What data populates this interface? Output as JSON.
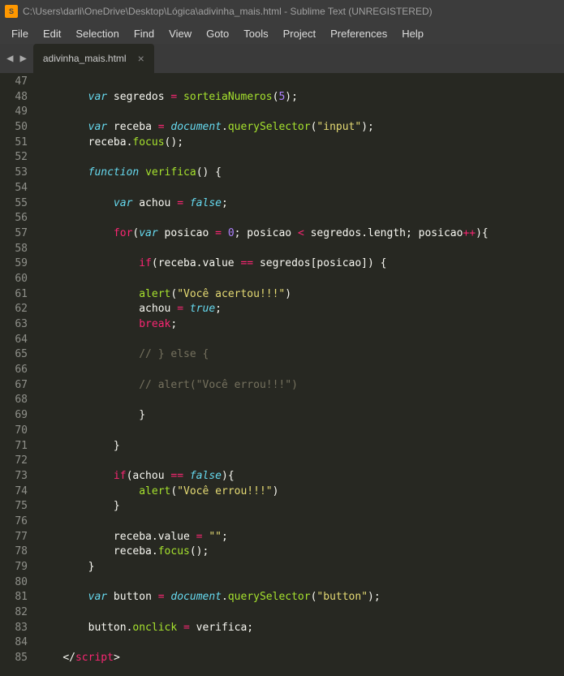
{
  "window": {
    "title": "C:\\Users\\darli\\OneDrive\\Desktop\\Lógica\\adivinha_mais.html - Sublime Text (UNREGISTERED)"
  },
  "menu": {
    "items": [
      "File",
      "Edit",
      "Selection",
      "Find",
      "View",
      "Goto",
      "Tools",
      "Project",
      "Preferences",
      "Help"
    ]
  },
  "tab": {
    "name": "adivinha_mais.html"
  },
  "gutter": {
    "start": 47,
    "end": 85
  },
  "code": {
    "lines": [
      {
        "n": 47,
        "indent": 1,
        "tokens": []
      },
      {
        "n": 48,
        "indent": 0,
        "tokens": [
          {
            "t": "        ",
            "c": "punc"
          },
          {
            "t": "var",
            "c": "stor"
          },
          {
            "t": " segredos ",
            "c": "name"
          },
          {
            "t": "=",
            "c": "kw2"
          },
          {
            "t": " ",
            "c": "punc"
          },
          {
            "t": "sorteiaNumeros",
            "c": "func"
          },
          {
            "t": "(",
            "c": "punc"
          },
          {
            "t": "5",
            "c": "num"
          },
          {
            "t": ");",
            "c": "punc"
          }
        ]
      },
      {
        "n": 49,
        "indent": 1,
        "tokens": []
      },
      {
        "n": 50,
        "indent": 0,
        "tokens": [
          {
            "t": "        ",
            "c": "punc"
          },
          {
            "t": "var",
            "c": "stor"
          },
          {
            "t": " receba ",
            "c": "name"
          },
          {
            "t": "=",
            "c": "kw2"
          },
          {
            "t": " ",
            "c": "punc"
          },
          {
            "t": "document",
            "c": "stor"
          },
          {
            "t": ".",
            "c": "punc"
          },
          {
            "t": "querySelector",
            "c": "func"
          },
          {
            "t": "(",
            "c": "punc"
          },
          {
            "t": "\"input\"",
            "c": "str"
          },
          {
            "t": ");",
            "c": "punc"
          }
        ]
      },
      {
        "n": 51,
        "indent": 0,
        "tokens": [
          {
            "t": "        receba.",
            "c": "name"
          },
          {
            "t": "focus",
            "c": "func"
          },
          {
            "t": "();",
            "c": "punc"
          }
        ]
      },
      {
        "n": 52,
        "indent": 1,
        "tokens": []
      },
      {
        "n": 53,
        "indent": 0,
        "tokens": [
          {
            "t": "        ",
            "c": "punc"
          },
          {
            "t": "function",
            "c": "stor"
          },
          {
            "t": " ",
            "c": "punc"
          },
          {
            "t": "verifica",
            "c": "func"
          },
          {
            "t": "() {",
            "c": "punc"
          }
        ]
      },
      {
        "n": 54,
        "indent": 2,
        "tokens": []
      },
      {
        "n": 55,
        "indent": 0,
        "tokens": [
          {
            "t": "            ",
            "c": "punc"
          },
          {
            "t": "var",
            "c": "stor"
          },
          {
            "t": " achou ",
            "c": "name"
          },
          {
            "t": "=",
            "c": "kw2"
          },
          {
            "t": " ",
            "c": "punc"
          },
          {
            "t": "false",
            "c": "stor"
          },
          {
            "t": ";",
            "c": "punc"
          }
        ]
      },
      {
        "n": 56,
        "indent": 2,
        "tokens": []
      },
      {
        "n": 57,
        "indent": 0,
        "tokens": [
          {
            "t": "            ",
            "c": "punc"
          },
          {
            "t": "for",
            "c": "kw2"
          },
          {
            "t": "(",
            "c": "punc"
          },
          {
            "t": "var",
            "c": "stor"
          },
          {
            "t": " posicao ",
            "c": "name"
          },
          {
            "t": "=",
            "c": "kw2"
          },
          {
            "t": " ",
            "c": "punc"
          },
          {
            "t": "0",
            "c": "num"
          },
          {
            "t": "; posicao ",
            "c": "name"
          },
          {
            "t": "<",
            "c": "kw2"
          },
          {
            "t": " segredos.length; posicao",
            "c": "name"
          },
          {
            "t": "++",
            "c": "kw2"
          },
          {
            "t": "){",
            "c": "punc"
          }
        ]
      },
      {
        "n": 58,
        "indent": 3,
        "tokens": []
      },
      {
        "n": 59,
        "indent": 0,
        "tokens": [
          {
            "t": "                ",
            "c": "punc"
          },
          {
            "t": "if",
            "c": "kw2"
          },
          {
            "t": "(receba.value ",
            "c": "name"
          },
          {
            "t": "==",
            "c": "kw2"
          },
          {
            "t": " segredos[posicao]) {",
            "c": "name"
          }
        ]
      },
      {
        "n": 60,
        "indent": 4,
        "tokens": []
      },
      {
        "n": 61,
        "indent": 0,
        "tokens": [
          {
            "t": "                ",
            "c": "punc"
          },
          {
            "t": "alert",
            "c": "func"
          },
          {
            "t": "(",
            "c": "punc"
          },
          {
            "t": "\"Você acertou!!!\"",
            "c": "str"
          },
          {
            "t": ")",
            "c": "punc"
          }
        ]
      },
      {
        "n": 62,
        "indent": 0,
        "tokens": [
          {
            "t": "                achou ",
            "c": "name"
          },
          {
            "t": "=",
            "c": "kw2"
          },
          {
            "t": " ",
            "c": "punc"
          },
          {
            "t": "true",
            "c": "stor"
          },
          {
            "t": ";",
            "c": "punc"
          }
        ]
      },
      {
        "n": 63,
        "indent": 0,
        "tokens": [
          {
            "t": "                ",
            "c": "punc"
          },
          {
            "t": "break",
            "c": "kw2"
          },
          {
            "t": ";",
            "c": "punc"
          }
        ]
      },
      {
        "n": 64,
        "indent": 4,
        "tokens": []
      },
      {
        "n": 65,
        "indent": 0,
        "tokens": [
          {
            "t": "                ",
            "c": "punc"
          },
          {
            "t": "// } else {",
            "c": "com"
          }
        ]
      },
      {
        "n": 66,
        "indent": 4,
        "tokens": []
      },
      {
        "n": 67,
        "indent": 0,
        "tokens": [
          {
            "t": "                ",
            "c": "punc"
          },
          {
            "t": "// alert(\"Você errou!!!\")",
            "c": "com"
          }
        ]
      },
      {
        "n": 68,
        "indent": 4,
        "tokens": []
      },
      {
        "n": 69,
        "indent": 0,
        "tokens": [
          {
            "t": "                }",
            "c": "punc"
          }
        ]
      },
      {
        "n": 70,
        "indent": 3,
        "tokens": []
      },
      {
        "n": 71,
        "indent": 0,
        "tokens": [
          {
            "t": "            }",
            "c": "punc"
          }
        ]
      },
      {
        "n": 72,
        "indent": 2,
        "tokens": []
      },
      {
        "n": 73,
        "indent": 0,
        "tokens": [
          {
            "t": "            ",
            "c": "punc"
          },
          {
            "t": "if",
            "c": "kw2"
          },
          {
            "t": "(achou ",
            "c": "name"
          },
          {
            "t": "==",
            "c": "kw2"
          },
          {
            "t": " ",
            "c": "punc"
          },
          {
            "t": "false",
            "c": "stor"
          },
          {
            "t": "){",
            "c": "punc"
          }
        ]
      },
      {
        "n": 74,
        "indent": 0,
        "tokens": [
          {
            "t": "                ",
            "c": "punc"
          },
          {
            "t": "alert",
            "c": "func"
          },
          {
            "t": "(",
            "c": "punc"
          },
          {
            "t": "\"Você errou!!!\"",
            "c": "str"
          },
          {
            "t": ")",
            "c": "punc"
          }
        ]
      },
      {
        "n": 75,
        "indent": 0,
        "tokens": [
          {
            "t": "            }",
            "c": "punc"
          }
        ]
      },
      {
        "n": 76,
        "indent": 2,
        "tokens": []
      },
      {
        "n": 77,
        "indent": 0,
        "tokens": [
          {
            "t": "            receba.value ",
            "c": "name"
          },
          {
            "t": "=",
            "c": "kw2"
          },
          {
            "t": " ",
            "c": "punc"
          },
          {
            "t": "\"\"",
            "c": "str"
          },
          {
            "t": ";",
            "c": "punc"
          }
        ]
      },
      {
        "n": 78,
        "indent": 0,
        "tokens": [
          {
            "t": "            receba.",
            "c": "name"
          },
          {
            "t": "focus",
            "c": "func"
          },
          {
            "t": "();",
            "c": "punc"
          }
        ]
      },
      {
        "n": 79,
        "indent": 0,
        "tokens": [
          {
            "t": "        }",
            "c": "punc"
          }
        ]
      },
      {
        "n": 80,
        "indent": 1,
        "tokens": []
      },
      {
        "n": 81,
        "indent": 0,
        "tokens": [
          {
            "t": "        ",
            "c": "punc"
          },
          {
            "t": "var",
            "c": "stor"
          },
          {
            "t": " button ",
            "c": "name"
          },
          {
            "t": "=",
            "c": "kw2"
          },
          {
            "t": " ",
            "c": "punc"
          },
          {
            "t": "document",
            "c": "stor"
          },
          {
            "t": ".",
            "c": "punc"
          },
          {
            "t": "querySelector",
            "c": "func"
          },
          {
            "t": "(",
            "c": "punc"
          },
          {
            "t": "\"button\"",
            "c": "str"
          },
          {
            "t": ");",
            "c": "punc"
          }
        ]
      },
      {
        "n": 82,
        "indent": 1,
        "tokens": []
      },
      {
        "n": 83,
        "indent": 0,
        "tokens": [
          {
            "t": "        button.",
            "c": "name"
          },
          {
            "t": "onclick",
            "c": "func"
          },
          {
            "t": " ",
            "c": "punc"
          },
          {
            "t": "=",
            "c": "kw2"
          },
          {
            "t": " verifica;",
            "c": "name"
          }
        ]
      },
      {
        "n": 84,
        "indent": 1,
        "tokens": []
      },
      {
        "n": 85,
        "indent": 0,
        "tokens": [
          {
            "t": "    ",
            "c": "punc"
          },
          {
            "t": "</",
            "c": "tagp"
          },
          {
            "t": "script",
            "c": "tag"
          },
          {
            "t": ">",
            "c": "tagp"
          }
        ]
      }
    ]
  }
}
